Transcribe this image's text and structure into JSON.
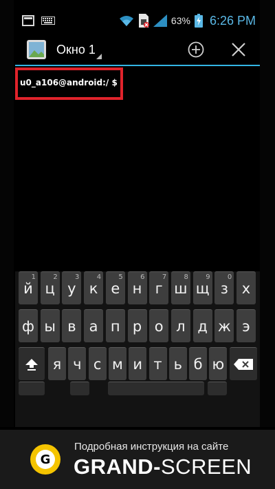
{
  "status_bar": {
    "battery_percent": "63%",
    "time": "6:26 PM",
    "icons": [
      "screenshot-icon",
      "keyboard-icon",
      "wifi-icon",
      "no-sim-icon",
      "signal-icon",
      "battery-charging-icon"
    ]
  },
  "action_bar": {
    "window_title": "Окно 1",
    "icons": [
      "terminal-app-icon",
      "add-window-icon",
      "close-window-icon"
    ]
  },
  "terminal": {
    "prompt": "u0_a106@android:/ $",
    "highlight_color": "#e0232b"
  },
  "keyboard": {
    "rows": [
      {
        "keys": [
          {
            "label": "й",
            "hint": "1"
          },
          {
            "label": "ц",
            "hint": "2"
          },
          {
            "label": "у",
            "hint": "3"
          },
          {
            "label": "к",
            "hint": "4"
          },
          {
            "label": "е",
            "hint": "5"
          },
          {
            "label": "н",
            "hint": "6"
          },
          {
            "label": "г",
            "hint": "7"
          },
          {
            "label": "ш",
            "hint": "8"
          },
          {
            "label": "щ",
            "hint": "9"
          },
          {
            "label": "з",
            "hint": "0"
          },
          {
            "label": "х",
            "hint": ""
          }
        ]
      },
      {
        "keys": [
          {
            "label": "ф",
            "hint": ""
          },
          {
            "label": "ы",
            "hint": ""
          },
          {
            "label": "в",
            "hint": ""
          },
          {
            "label": "а",
            "hint": ""
          },
          {
            "label": "п",
            "hint": ""
          },
          {
            "label": "р",
            "hint": ""
          },
          {
            "label": "о",
            "hint": ""
          },
          {
            "label": "л",
            "hint": ""
          },
          {
            "label": "д",
            "hint": ""
          },
          {
            "label": "ж",
            "hint": ""
          },
          {
            "label": "э",
            "hint": ""
          }
        ]
      },
      {
        "keys": [
          {
            "label": "я",
            "hint": ""
          },
          {
            "label": "ч",
            "hint": ""
          },
          {
            "label": "с",
            "hint": ""
          },
          {
            "label": "м",
            "hint": ""
          },
          {
            "label": "и",
            "hint": ""
          },
          {
            "label": "т",
            "hint": ""
          },
          {
            "label": "ь",
            "hint": ""
          },
          {
            "label": "б",
            "hint": ""
          },
          {
            "label": "ю",
            "hint": ""
          }
        ]
      }
    ],
    "shift_icon": "shift-icon",
    "backspace_icon": "backspace-icon"
  },
  "banner": {
    "caption": "Подробная инструкция на сайте",
    "brand_bold": "GRAND-",
    "brand_regular": "SCREEN",
    "logo_letter": "G",
    "accent": "#f5c400"
  }
}
